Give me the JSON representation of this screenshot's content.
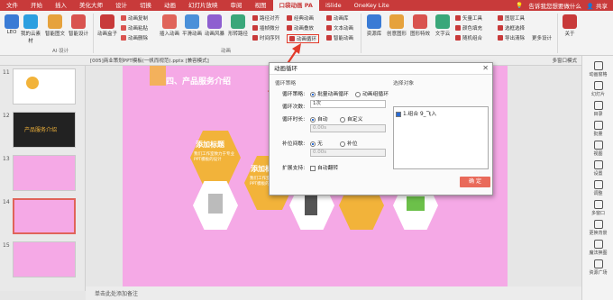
{
  "tabs": [
    "文件",
    "开始",
    "插入",
    "美化大师",
    "设计",
    "切换",
    "动画",
    "幻灯片放映",
    "审阅",
    "视图",
    "口袋动画 PA",
    "iSlide",
    "OneKey Lite"
  ],
  "active_tab": "口袋动画 PA",
  "tell_me": "告诉我您想要做什么",
  "share": "共享",
  "ribbon": {
    "btn_leo": "LEO",
    "btn_cloud": "我的云素材",
    "btn_smart_fill": "智能图文",
    "btn_smart_design": "智能设计",
    "btn_anim_box": "动画盒子",
    "ai_group": "AI·设计",
    "anim_copy": "动画复制",
    "anim_paste": "动画粘贴",
    "anim_delete": "动画删除",
    "btn_insert_anim": "插入动画",
    "btn_smooth": "平滑动画",
    "btn_anim_style": "动画风暴",
    "btn_shape_path": "形转路径",
    "path_align": "路径对齐",
    "playback_cap": "插帧微分",
    "time_series": "时间序列",
    "classic_anim": "经典动画",
    "loop_anim": "动画循环",
    "stack_anim": "动画叠放",
    "anim_group": "动画",
    "anim_mark": "动画库",
    "text_anim": "文本动画",
    "smart_anim": "智能动画",
    "btn_material": "资源库",
    "btn_creative": "创意图形",
    "btn_shape_lib": "图形特效",
    "btn_text_art": "文字云",
    "vector_tool": "矢量工具",
    "color_fill": "颜色填充",
    "random_group": "随机组合",
    "layer_tool": "图层工具",
    "select_tool": "选框选择",
    "export_clear": "导出清除",
    "more_tools": "更多设计",
    "btn_about": "关于"
  },
  "address": "[005]商业策划PPT模板(一帆而视范).pptx [兼容模式]",
  "multi_window": "多窗口模式",
  "slide_numbers": [
    "11",
    "12",
    "13",
    "14",
    "15"
  ],
  "thumb_titles": {
    "t12": "产品服务介绍"
  },
  "slide": {
    "title": "四、产品服务介绍",
    "card1_title": "添加标题",
    "card1_text": "我们工作室致力于专业PPT模板的设计",
    "card2_title": "添加标题",
    "card2_text": "我们工作室致力于专业PPT模板的设计"
  },
  "status_text": "单击此处添加备注",
  "right_panel": [
    "动画窗格",
    "幻灯片",
    "目录",
    "批量",
    "视图",
    "设置",
    "调整",
    "多窗口",
    "更换背景",
    "魔法换图",
    "资源广场"
  ],
  "dialog": {
    "title": "动画循环",
    "section_strategy": "循环策略",
    "strategy_label": "循环策略:",
    "strategy_opt1": "批量动画循环",
    "strategy_opt2": "动画组循环",
    "count_label": "循环次数:",
    "count_value": "1次",
    "time_label": "循环时长:",
    "time_opt1": "自动",
    "time_opt2": "自定义",
    "time_value": "0.00s",
    "gap_label": "补位间歇:",
    "gap_opt1": "无",
    "gap_opt2": "补位",
    "gap_value": "0.00s",
    "ext_label": "扩展支持:",
    "ext_opt": "自动翻转",
    "select_label": "选择对象",
    "list_item": "1.组合 9_飞入",
    "ok": "确 定"
  },
  "highlight_button": "动画循环",
  "colors": {
    "brand": "#c83a3a",
    "slide_bg": "#f5a9e6",
    "accent": "#e96a5a",
    "hex_orange": "#f2b33a"
  }
}
